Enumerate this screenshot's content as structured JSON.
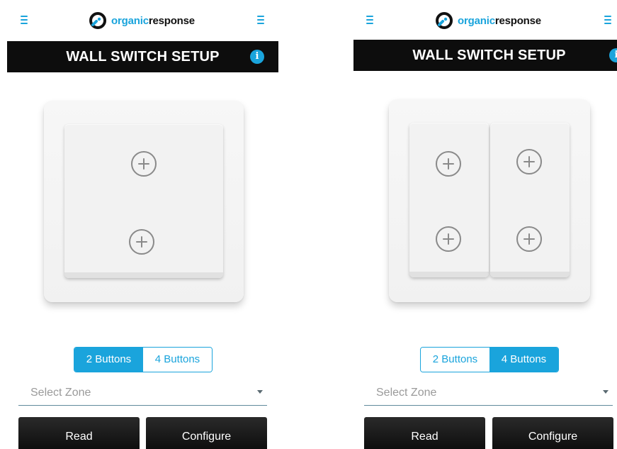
{
  "colors": {
    "accent": "#1aa4dc",
    "bar": "#0d0d0d",
    "text_dark": "#111111"
  },
  "screens": [
    {
      "logo": {
        "part1": "organic",
        "part2": "response"
      },
      "title": "WALL SWITCH SETUP",
      "info_icon": "i",
      "switch_layout": "2 buttons",
      "toggle": {
        "option1": "2 Buttons",
        "option2": "4 Buttons",
        "active": "2 Buttons"
      },
      "zone": {
        "placeholder": "Select Zone"
      },
      "actions": {
        "read": "Read",
        "configure": "Configure"
      }
    },
    {
      "logo": {
        "part1": "organic",
        "part2": "response"
      },
      "title": "WALL SWITCH SETUP",
      "info_icon": "i",
      "switch_layout": "4 buttons",
      "toggle": {
        "option1": "2 Buttons",
        "option2": "4 Buttons",
        "active": "4 Buttons"
      },
      "zone": {
        "placeholder": "Select Zone"
      },
      "actions": {
        "read": "Read",
        "configure": "Configure"
      }
    }
  ]
}
